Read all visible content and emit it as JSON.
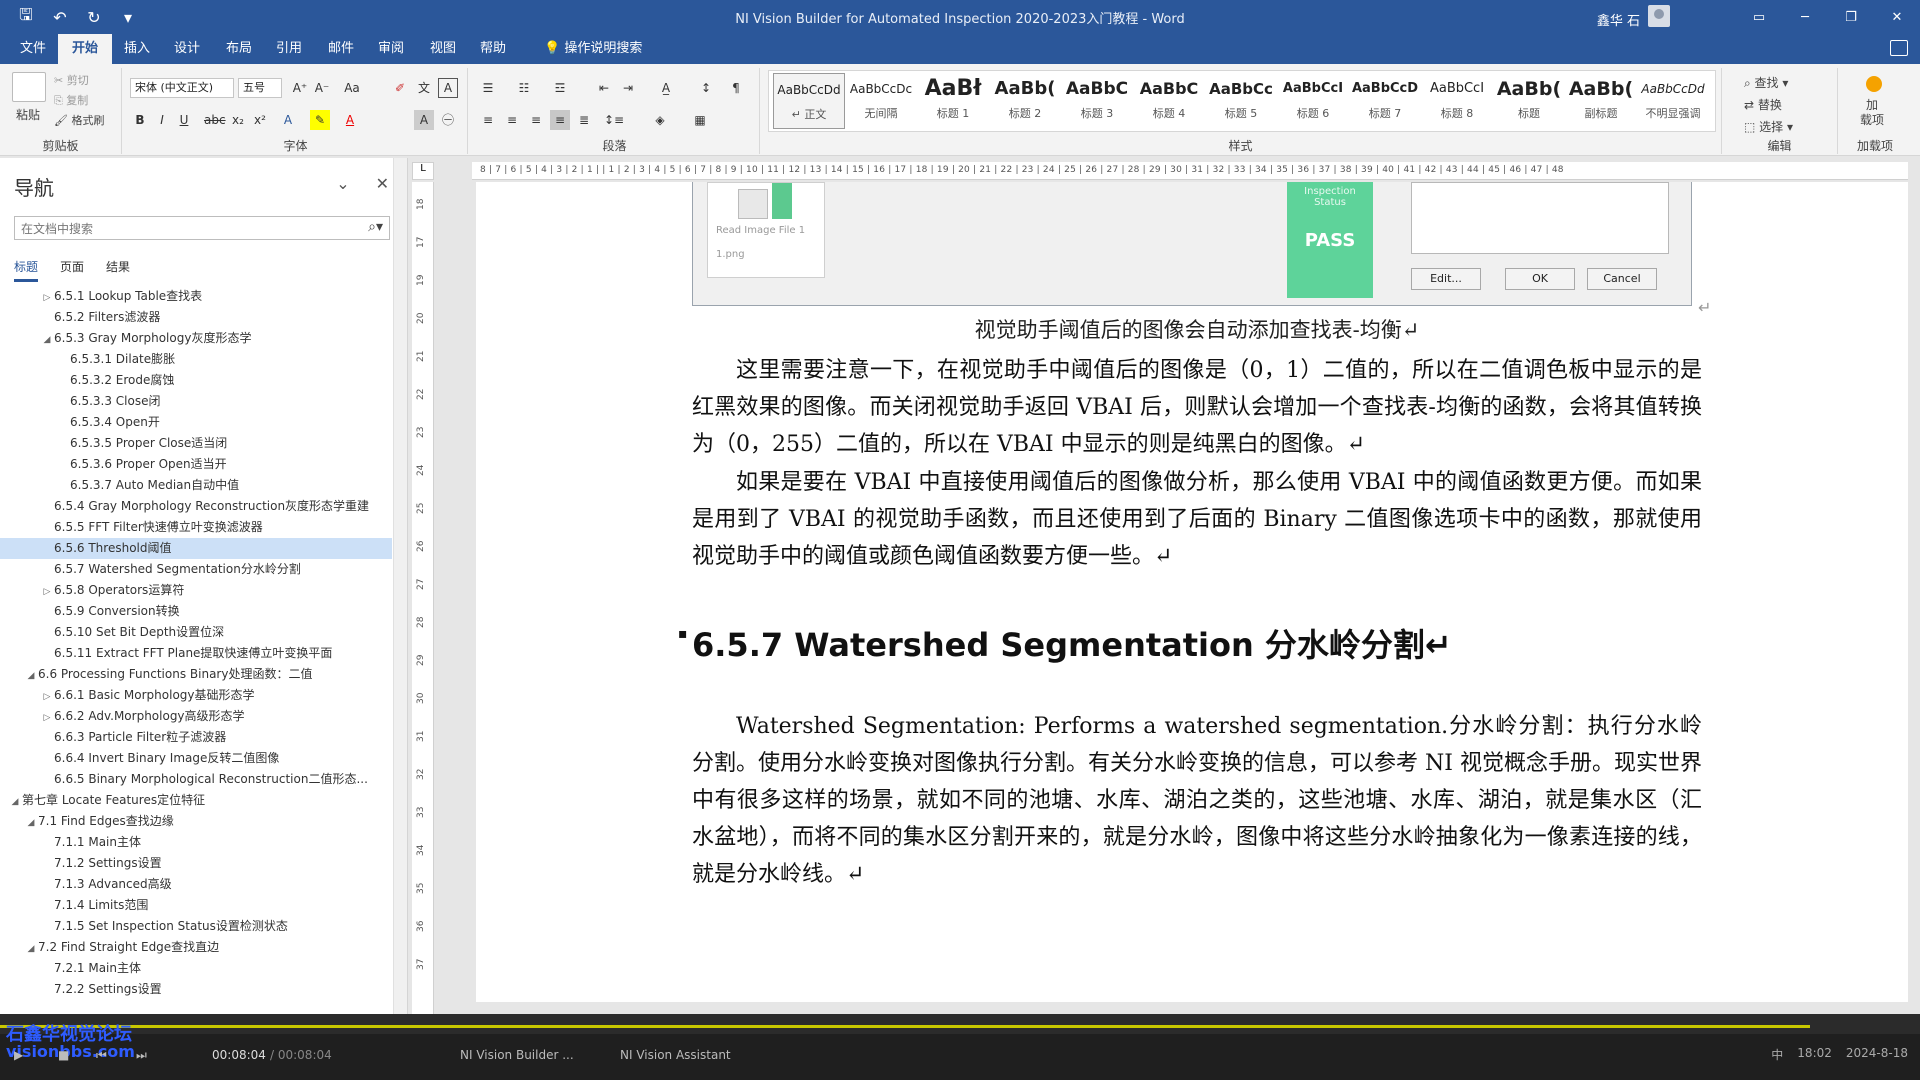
{
  "window": {
    "title": "NI Vision Builder for Automated Inspection 2020-2023入门教程  -  Word",
    "user": "鑫华 石",
    "buttons": [
      "▭",
      "─",
      "❐",
      "✕"
    ]
  },
  "menu": {
    "tabs": [
      "文件",
      "开始",
      "插入",
      "设计",
      "布局",
      "引用",
      "邮件",
      "审阅",
      "视图",
      "帮助"
    ],
    "active": "开始",
    "search": "操作说明搜索"
  },
  "ribbon": {
    "clipboard": {
      "paste": "粘贴",
      "cut": "剪切",
      "copy": "复制",
      "painter": "格式刷",
      "label": "剪贴板"
    },
    "font": {
      "name": "宋体 (中文正文)",
      "size": "五号",
      "label": "字体"
    },
    "paragraph": {
      "label": "段落"
    },
    "styles": {
      "label": "样式",
      "items": [
        {
          "sample": "AaBbCcDd",
          "name": "↵ 正文",
          "size": 12,
          "bold": false
        },
        {
          "sample": "AaBbCcDc",
          "name": "无间隔",
          "size": 12,
          "bold": false
        },
        {
          "sample": "AaBł",
          "name": "标题 1",
          "size": 22,
          "bold": true
        },
        {
          "sample": "AaBb(",
          "name": "标题 2",
          "size": 18,
          "bold": true
        },
        {
          "sample": "AaBbC",
          "name": "标题 3",
          "size": 17,
          "bold": true
        },
        {
          "sample": "AaBbC",
          "name": "标题 4",
          "size": 16,
          "bold": true
        },
        {
          "sample": "AaBbCc",
          "name": "标题 5",
          "size": 15,
          "bold": true
        },
        {
          "sample": "AaBbCcI",
          "name": "标题 6",
          "size": 13,
          "bold": true
        },
        {
          "sample": "AaBbCcD",
          "name": "标题 7",
          "size": 13,
          "bold": true
        },
        {
          "sample": "AaBbCcI",
          "name": "标题 8",
          "size": 13,
          "bold": false
        },
        {
          "sample": "AaBb(",
          "name": "标题",
          "size": 19,
          "bold": true
        },
        {
          "sample": "AaBb(",
          "name": "副标题",
          "size": 19,
          "bold": true
        },
        {
          "sample": "AaBbCcDd",
          "name": "不明显强调",
          "size": 12,
          "bold": false
        }
      ]
    },
    "editing": {
      "find": "查找",
      "replace": "替换",
      "select": "选择",
      "label": "编辑"
    },
    "addins": {
      "name": "加\n载项",
      "label": "加载项"
    }
  },
  "nav": {
    "title": "导航",
    "search_placeholder": "在文档中搜索",
    "tabs": [
      "标题",
      "页面",
      "结果"
    ],
    "items": [
      {
        "level": 3,
        "toggle": "▷",
        "text": "6.5.1 Lookup Table查找表"
      },
      {
        "level": 3,
        "toggle": "",
        "text": "6.5.2 Filters滤波器"
      },
      {
        "level": 3,
        "toggle": "◢",
        "text": "6.5.3 Gray Morphology灰度形态学"
      },
      {
        "level": 4,
        "toggle": "",
        "text": "6.5.3.1 Dilate膨胀"
      },
      {
        "level": 4,
        "toggle": "",
        "text": "6.5.3.2 Erode腐蚀"
      },
      {
        "level": 4,
        "toggle": "",
        "text": "6.5.3.3 Close闭"
      },
      {
        "level": 4,
        "toggle": "",
        "text": "6.5.3.4 Open开"
      },
      {
        "level": 4,
        "toggle": "",
        "text": "6.5.3.5 Proper Close适当闭"
      },
      {
        "level": 4,
        "toggle": "",
        "text": "6.5.3.6 Proper Open适当开"
      },
      {
        "level": 4,
        "toggle": "",
        "text": "6.5.3.7 Auto Median自动中值"
      },
      {
        "level": 3,
        "toggle": "",
        "text": "6.5.4 Gray Morphology Reconstruction灰度形态学重建"
      },
      {
        "level": 3,
        "toggle": "",
        "text": "6.5.5 FFT Filter快速傅立叶变换滤波器"
      },
      {
        "level": 3,
        "toggle": "",
        "text": "6.5.6 Threshold阈值",
        "selected": true
      },
      {
        "level": 3,
        "toggle": "",
        "text": "6.5.7 Watershed Segmentation分水岭分割"
      },
      {
        "level": 3,
        "toggle": "▷",
        "text": "6.5.8 Operators运算符"
      },
      {
        "level": 3,
        "toggle": "",
        "text": "6.5.9 Conversion转换"
      },
      {
        "level": 3,
        "toggle": "",
        "text": "6.5.10 Set Bit Depth设置位深"
      },
      {
        "level": 3,
        "toggle": "",
        "text": "6.5.11 Extract FFT Plane提取快速傅立叶变换平面"
      },
      {
        "level": 2,
        "toggle": "◢",
        "text": "6.6 Processing Functions Binary处理函数：二值"
      },
      {
        "level": 3,
        "toggle": "▷",
        "text": "6.6.1 Basic Morphology基础形态学"
      },
      {
        "level": 3,
        "toggle": "▷",
        "text": "6.6.2 Adv.Morphology高级形态学"
      },
      {
        "level": 3,
        "toggle": "",
        "text": "6.6.3 Particle Filter粒子滤波器"
      },
      {
        "level": 3,
        "toggle": "",
        "text": "6.6.4 Invert Binary Image反转二值图像"
      },
      {
        "level": 3,
        "toggle": "",
        "text": "6.6.5 Binary Morphological Reconstruction二值形态..."
      },
      {
        "level": 1,
        "toggle": "◢",
        "text": "第七章 Locate Features定位特征"
      },
      {
        "level": 2,
        "toggle": "◢",
        "text": "7.1 Find Edges查找边缘"
      },
      {
        "level": 3,
        "toggle": "",
        "text": "7.1.1 Main主体"
      },
      {
        "level": 3,
        "toggle": "",
        "text": "7.1.2 Settings设置"
      },
      {
        "level": 3,
        "toggle": "",
        "text": "7.1.3 Advanced高级"
      },
      {
        "level": 3,
        "toggle": "",
        "text": "7.1.4 Limits范围"
      },
      {
        "level": 3,
        "toggle": "",
        "text": "7.1.5 Set Inspection Status设置检测状态"
      },
      {
        "level": 2,
        "toggle": "◢",
        "text": "7.2 Find Straight Edge查找直边"
      },
      {
        "level": 3,
        "toggle": "",
        "text": "7.2.1 Main主体"
      },
      {
        "level": 3,
        "toggle": "",
        "text": "7.2.2 Settings设置"
      }
    ]
  },
  "ruler": {
    "h": "8 | 7 | 6 | 5 | 4 | 3 | 2 | 1 |   | 1 | 2 | 3 | 4 | 5 | 6 | 7 | 8 | 9 | 10 | 11 | 12 | 13 | 14 | 15 | 16 | 17 | 18 | 19 | 20 | 21 | 22 | 23 | 24 | 25 | 26 | 27 | 28 | 29 | 30 | 31 | 32 | 33 | 34 | 35 | 36 | 37 | 38 | 39 | 40 | 41 | 42 | 43 | 44 | 45 | 46 | 47 | 48",
    "v": [
      "18",
      "17",
      "19",
      "20",
      "21",
      "22",
      "23",
      "24",
      "25",
      "26",
      "27",
      "28",
      "29",
      "30",
      "31",
      "32",
      "33",
      "34",
      "35",
      "36",
      "37"
    ],
    "corner": "L"
  },
  "screenshot": {
    "thumb_label": "Read Image File 1",
    "thumb_file": "1.png",
    "status_label": "Inspection\nStatus",
    "status_value": "PASS",
    "edit": "Edit...",
    "ok": "OK",
    "cancel": "Cancel"
  },
  "document": {
    "caption": "视觉助手阈值后的图像会自动添加查找表-均衡↵",
    "para1": "这里需要注意一下，在视觉助手中阈值后的图像是（0，1）二值的，所以在二值调色板中显示的是红黑效果的图像。而关闭视觉助手返回 VBAI 后，则默认会增加一个查找表-均衡的函数，会将其值转换为（0，255）二值的，所以在 VBAI 中显示的则是纯黑白的图像。↵",
    "para2": "如果是要在 VBAI 中直接使用阈值后的图像做分析，那么使用 VBAI 中的阈值函数更方便。而如果是用到了 VBAI 的视觉助手函数，而且还使用到了后面的 Binary 二值图像选项卡中的函数，那就使用视觉助手中的阈值或颜色阈值函数要方便一些。↵",
    "heading": "6.5.7 Watershed Segmentation 分水岭分割↵",
    "para3": "Watershed Segmentation: Performs a watershed segmentation.分水岭分割：执行分水岭分割。使用分水岭变换对图像执行分割。有关分水岭变换的信息，可以参考 NI 视觉概念手册。现实世界中有很多这样的场景，就如不同的池塘、水库、湖泊之类的，这些池塘、水库、湖泊，就是集水区（汇水盆地），而将不同的集水区分割开来的，就是分水岭，图像中将这些分水岭抽象化为一像素连接的线，就是分水岭线。↵"
  },
  "taskbar": {
    "time": "00:08:04",
    "total": "/ 00:08:04",
    "apps": [
      "NI Vision Builder ...",
      "NI Vision Assistant"
    ],
    "watermark1": "石鑫华视觉论坛",
    "watermark2": "visionbbs.com",
    "tray_time": "18:02",
    "tray_date": "2024-8-18"
  },
  "colors": {
    "accent": "#2b579a",
    "pass": "#5ed39a",
    "selection": "#cce0f7"
  }
}
